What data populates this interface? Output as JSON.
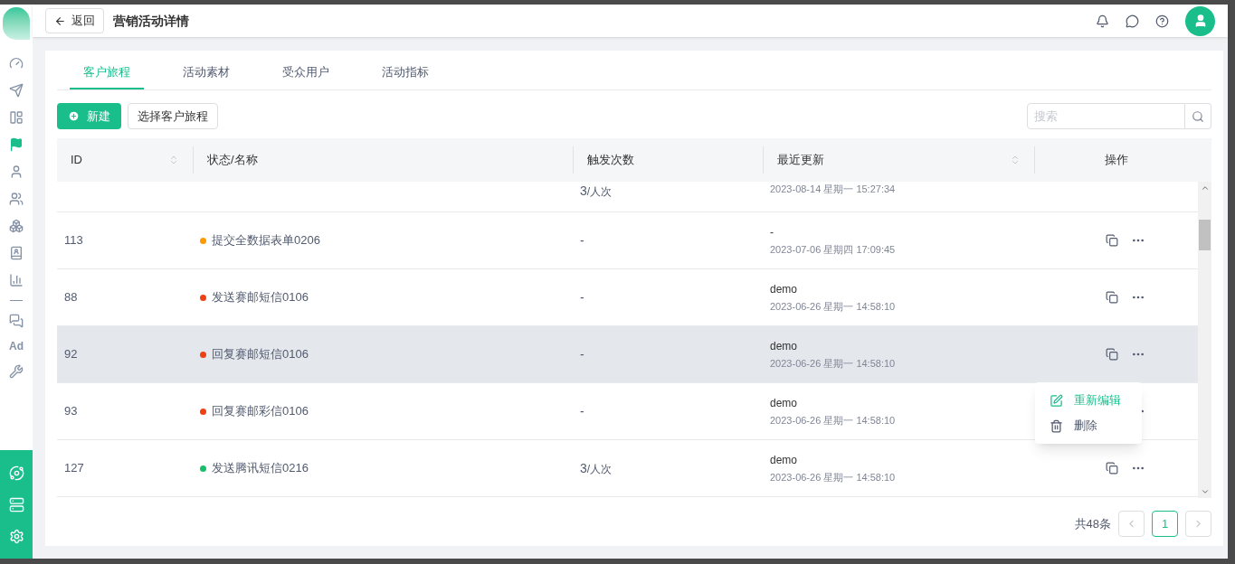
{
  "header": {
    "back": "返回",
    "title": "营销活动详情"
  },
  "sidebar": {
    "items": [
      {
        "selected": false
      },
      {
        "selected": false
      },
      {
        "selected": false
      },
      {
        "selected": true
      },
      {
        "selected": false
      },
      {
        "selected": false
      },
      {
        "selected": false
      },
      {
        "selected": false
      },
      {
        "selected": false
      },
      {
        "selected": false
      },
      {
        "label": "Ad",
        "selected": false
      },
      {
        "selected": false
      }
    ]
  },
  "tabs": [
    {
      "label": "客户旅程",
      "selected": true
    },
    {
      "label": "活动素材",
      "selected": false
    },
    {
      "label": "受众用户",
      "selected": false
    },
    {
      "label": "活动指标",
      "selected": false
    }
  ],
  "toolbar": {
    "new": "新建",
    "select": "选择客户旅程",
    "search": {
      "placeholder": "搜索"
    }
  },
  "table": {
    "columns": [
      {
        "label": "ID",
        "sortable": true
      },
      {
        "label": "状态/名称",
        "sortable": false
      },
      {
        "label": "触发次数",
        "sortable": false
      },
      {
        "label": "最近更新",
        "sortable": true
      },
      {
        "label": "操作",
        "sortable": false
      }
    ],
    "rows": [
      {
        "trigger": "3",
        "unit": "/人次",
        "time": "2023-08-14 星期一 15:27:34",
        "selected": false
      },
      {
        "id": "113",
        "name": "提交全数据表单0206",
        "color": "#ff9900",
        "trigger": "-",
        "user": "-",
        "time": "2023-07-06 星期四 17:09:45",
        "selected": false
      },
      {
        "id": "88",
        "name": "发送赛邮短信0106",
        "color": "#ed4014",
        "trigger": "-",
        "user": "demo",
        "time": "2023-06-26 星期一 14:58:10",
        "selected": false
      },
      {
        "id": "92",
        "name": "回复赛邮短信0106",
        "color": "#ed4014",
        "trigger": "-",
        "user": "demo",
        "time": "2023-06-26 星期一 14:58:10",
        "selected": true
      },
      {
        "id": "93",
        "name": "回复赛邮彩信0106",
        "color": "#ed4014",
        "trigger": "-",
        "user": "demo",
        "time": "2023-06-26 星期一 14:58:10",
        "selected": false
      },
      {
        "id": "127",
        "name": "发送腾讯短信0216",
        "color": "#19be6b",
        "trigger": "3",
        "unit": "/人次",
        "user": "demo",
        "time": "2023-06-26 星期一 14:58:10",
        "selected": false
      }
    ]
  },
  "menu": {
    "items": [
      {
        "kind": "edit",
        "label": "重新编辑",
        "highlighted": true
      },
      {
        "kind": "delete",
        "label": "删除",
        "highlighted": false
      }
    ]
  },
  "pagination": {
    "total": "共48条",
    "pages": [
      {
        "label": "1",
        "selected": true
      }
    ]
  }
}
